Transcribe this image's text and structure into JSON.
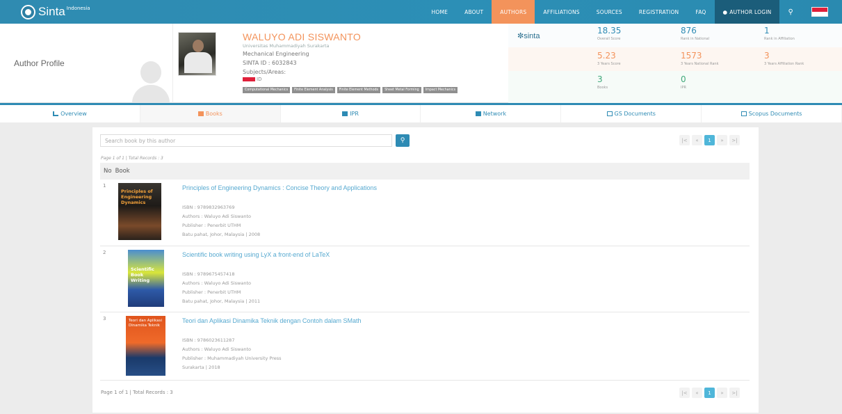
{
  "brand": {
    "name": "Sinta",
    "sup": "Indonesia"
  },
  "nav": [
    "HOME",
    "ABOUT",
    "AUTHORS",
    "AFFILIATIONS",
    "SOURCES",
    "REGISTRATION",
    "FAQ"
  ],
  "login": "AUTHOR LOGIN",
  "header": {
    "label": "Author Profile"
  },
  "profile": {
    "name": "WALUYO ADI SISWANTO",
    "univ": "Universitas Muhammadiyah Surakarta",
    "dept": "Mechanical Engineering",
    "sinta_id": "SINTA ID : 6032843",
    "subjects": "Subjects/Areas:",
    "country": "ID",
    "tags": [
      "Computational Mechanics",
      "Finite Element Analysis",
      "Finite Element Methods",
      "Sheet Metal Forming",
      "Impact Mechanics"
    ]
  },
  "sinta_logo": "sinta",
  "stats": [
    {
      "v": "18.35",
      "l": "Overall Score"
    },
    {
      "v": "876",
      "l": "Rank in National"
    },
    {
      "v": "1",
      "l": "Rank in Affiliation"
    },
    {
      "v": "5.23",
      "l": "3 Years Score"
    },
    {
      "v": "1573",
      "l": "3 Years National Rank"
    },
    {
      "v": "3",
      "l": "3 Years Affiliation Rank"
    },
    {
      "v": "3",
      "l": "Books"
    },
    {
      "v": "0",
      "l": "IPR"
    }
  ],
  "tabs": [
    "Overview",
    "Books",
    "IPR",
    "Network",
    "GS Documents",
    "Scopus Documents"
  ],
  "search": {
    "placeholder": "Search book by this author"
  },
  "page_info": "Page 1 of 1 | Total Records : 3",
  "table": {
    "no": "No",
    "book": "Book"
  },
  "pager": {
    "first": "|<",
    "prev": "«",
    "page": "1",
    "next": "»",
    "last": ">|"
  },
  "books": [
    {
      "no": "1",
      "title": "Principles of Engineering Dynamics : Concise Theory and Applications",
      "isbn": "ISBN : 9789832963769",
      "authors": "Authors : Waluyo Adi Siswanto",
      "publisher": "Publisher : Penerbit UTHM",
      "place": "Batu pahat, Johor, Malaysia | 2008",
      "cover_text": "Principles of Engineering Dynamics"
    },
    {
      "no": "2",
      "title": "Scientific book writing using LyX a front-end of LaTeX",
      "isbn": "ISBN : 9789675457418",
      "authors": "Authors : Waluyo Adi Siswanto",
      "publisher": "Publisher : Penerbit UTHM",
      "place": "Batu pahat, Johor, Malaysia | 2011",
      "cover_text": "Scientific Book Writing"
    },
    {
      "no": "3",
      "title": "Teori dan Aplikasi Dinamika Teknik dengan Contoh dalam SMath",
      "isbn": "ISBN : 9786023611287",
      "authors": "Authors : Waluyo Adi Siswanto",
      "publisher": "Publisher : Muhammadiyah University Press",
      "place": "Surakarta | 2018",
      "cover_text": "Teori dan Aplikasi Dinamika Teknik"
    }
  ],
  "footer_info": "Page 1 of 1 | Total Records : 3"
}
